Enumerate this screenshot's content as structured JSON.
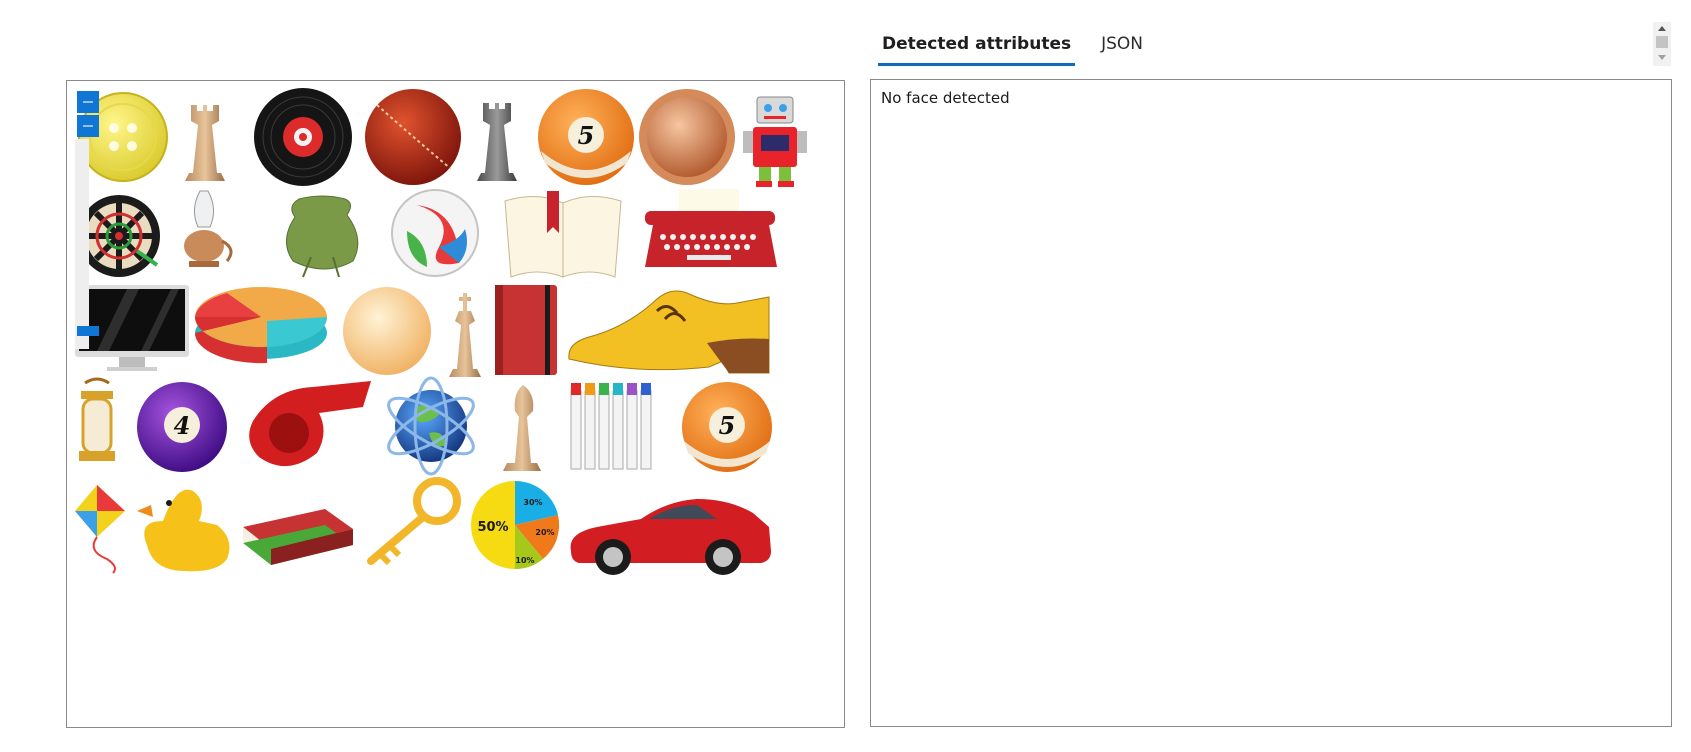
{
  "tabs": [
    {
      "label": "Detected attributes",
      "active": true
    },
    {
      "label": "JSON",
      "active": false
    }
  ],
  "results": {
    "message": "No face detected"
  },
  "image_objects": [
    "button-icon",
    "rook-icon",
    "vinyl-record-icon",
    "cricket-ball-icon",
    "rook-icon",
    "billiard-ball-5-icon",
    "copper-coin-icon",
    "robot-icon",
    "dartboard-icon",
    "oil-lamp-icon",
    "pouch-icon",
    "marble-icon",
    "open-book-icon",
    "typewriter-icon",
    "monitor-icon",
    "pie-chart-3d-icon",
    "ball-icon",
    "king-chess-piece-icon",
    "notebook-icon",
    "shoe-icon",
    "lantern-icon",
    "billiard-ball-4-icon",
    "whistle-icon",
    "globe-icon",
    "bishop-chess-piece-icon",
    "markers-icon",
    "billiard-ball-5-icon",
    "kite-icon",
    "rubber-duck-icon",
    "books-icon",
    "key-icon",
    "pie-chart-icon",
    "red-car-icon"
  ],
  "image_text": {
    "ball_five": "5",
    "ball_four": "4",
    "pie_50": "50%",
    "pie_30": "30%",
    "pie_20": "20%",
    "pie_10": "10%"
  },
  "colors": {
    "accent": "#0f6cbd",
    "zoom_control": "#0f76d6",
    "border": "#8a8a8a"
  }
}
